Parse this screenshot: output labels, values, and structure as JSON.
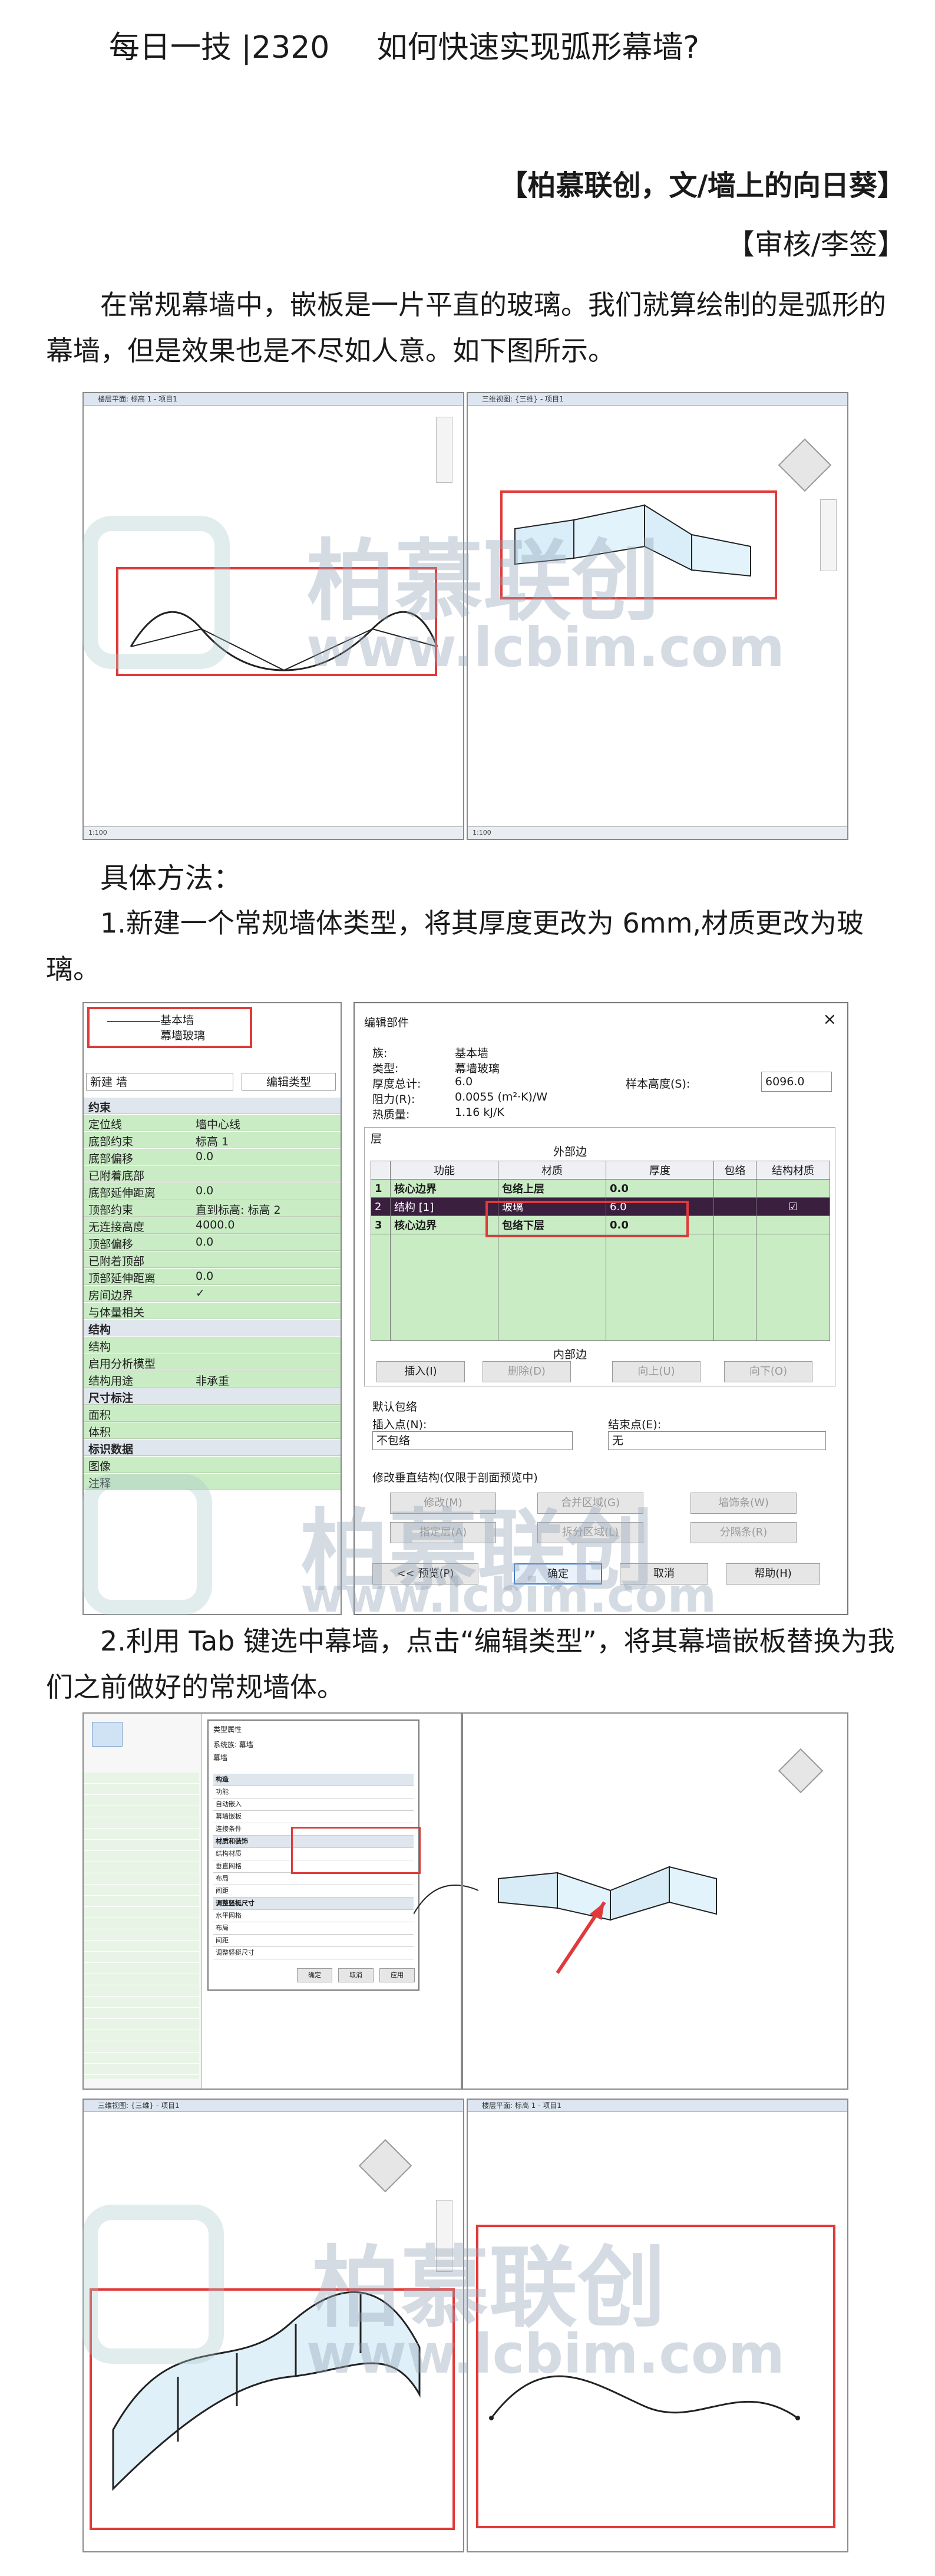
{
  "header": {
    "series": "每日一技 |2320",
    "title": "如何快速实现弧形幕墙?"
  },
  "byline": {
    "author": "【柏慕联创，文/墙上的向日葵】",
    "review": "【审核/李签】"
  },
  "intro": "在常规幕墙中，嵌板是一片平直的玻璃。我们就算绘制的是弧形的幕墙，但是效果也是不尽如人意。如下图所示。",
  "method_heading": "具体方法：",
  "step1": "1.新建一个常规墙体类型，将其厚度更改为 6mm,材质更改为玻璃。",
  "step2": "2.利用 Tab 键选中幕墙，点击“编辑类型”，将其幕墙嵌板替换为我们之前做好的常规墙体。",
  "watermark": {
    "brand": "柏慕联创",
    "url": "www.lcbim.com"
  },
  "fig1": {
    "left_title": "楼层平面: 标高 1 - 项目1",
    "right_title": "三维视图: {三维} - 项目1",
    "status": "1:100"
  },
  "props_panel": {
    "type_name_1": "基本墙",
    "type_name_2": "幕墙玻璃",
    "selector": "新建 墙",
    "edit_type": "编辑类型",
    "rows": [
      {
        "k": "约束",
        "v": "",
        "group": true
      },
      {
        "k": "定位线",
        "v": "墙中心线"
      },
      {
        "k": "底部约束",
        "v": "标高 1"
      },
      {
        "k": "底部偏移",
        "v": "0.0"
      },
      {
        "k": "已附着底部",
        "v": ""
      },
      {
        "k": "底部延伸距离",
        "v": "0.0"
      },
      {
        "k": "顶部约束",
        "v": "直到标高: 标高 2"
      },
      {
        "k": "无连接高度",
        "v": "4000.0"
      },
      {
        "k": "顶部偏移",
        "v": "0.0"
      },
      {
        "k": "已附着顶部",
        "v": ""
      },
      {
        "k": "顶部延伸距离",
        "v": "0.0"
      },
      {
        "k": "房间边界",
        "v": "✓"
      },
      {
        "k": "与体量相关",
        "v": ""
      },
      {
        "k": "结构",
        "v": "",
        "group": true
      },
      {
        "k": "结构",
        "v": ""
      },
      {
        "k": "启用分析模型",
        "v": ""
      },
      {
        "k": "结构用途",
        "v": "非承重"
      },
      {
        "k": "尺寸标注",
        "v": "",
        "group": true
      },
      {
        "k": "面积",
        "v": ""
      },
      {
        "k": "体积",
        "v": ""
      },
      {
        "k": "标识数据",
        "v": "",
        "group": true
      },
      {
        "k": "图像",
        "v": ""
      },
      {
        "k": "注释",
        "v": ""
      }
    ]
  },
  "dialog": {
    "title": "编辑部件",
    "family_label": "族:",
    "family": "基本墙",
    "type_label": "类型:",
    "type": "幕墙玻璃",
    "thickness_label": "厚度总计:",
    "thickness": "6.0",
    "resistance_label": "阻力(R):",
    "resistance": "0.0055 (m²·K)/W",
    "mass_label": "热质量:",
    "mass": "1.16 kJ/K",
    "sample_label": "样本高度(S):",
    "sample": "6096.0",
    "layers_label": "层",
    "exterior": "外部边",
    "interior": "内部边",
    "headers": [
      "",
      "功能",
      "材质",
      "厚度",
      "包络",
      "结构材质"
    ],
    "layers": [
      [
        "1",
        "核心边界",
        "包络上层",
        "0.0",
        "",
        ""
      ],
      [
        "2",
        "结构 [1]",
        "玻璃",
        "6.0",
        "",
        "☑"
      ],
      [
        "3",
        "核心边界",
        "包络下层",
        "0.0",
        "",
        ""
      ]
    ],
    "row_buttons": [
      "插入(I)",
      "删除(D)",
      "向上(U)",
      "向下(O)"
    ],
    "wrap_label": "默认包络",
    "insert_label": "插入点(N):",
    "insert_value": "不包络",
    "end_label": "结束点(E):",
    "end_value": "无",
    "modify_label": "修改垂直结构(仅限于剖面预览中)",
    "modify_buttons": [
      "修改(M)",
      "合并区域(G)",
      "墙饰条(W)",
      "指定层(A)",
      "拆分区域(L)",
      "分隔条(R)"
    ],
    "footer_buttons": [
      "<< 预览(P)",
      "确定",
      "取消",
      "帮助(H)"
    ]
  },
  "fig3": {
    "dialog_title": "类型属性",
    "family": "系统族: 幕墙",
    "type": "幕墙",
    "rows": [
      "构造",
      "功能",
      "自动嵌入",
      "幕墙嵌板",
      "连接条件",
      "材质和装饰",
      "结构材质",
      "垂直网格",
      "布局",
      "间距",
      "调整竖梃尺寸",
      "水平网格",
      "布局",
      "间距",
      "调整竖梃尺寸"
    ],
    "ok": "确定",
    "cancel": "取消",
    "apply": "应用"
  },
  "fig4": {
    "left_title": "三维视图: {三维} - 项目1",
    "right_title": "楼层平面: 标高 1 - 项目1"
  }
}
